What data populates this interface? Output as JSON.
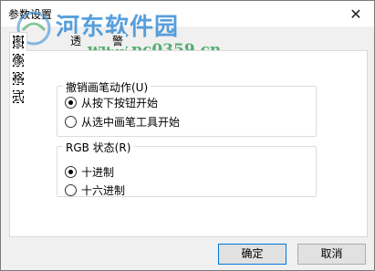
{
  "window": {
    "title": "参数设置",
    "close_glyph": "✕"
  },
  "watermark": {
    "site_name": "河东软件园",
    "url": "www.pc0359.cn"
  },
  "tabs": [
    {
      "label": "图像格式",
      "active": true
    },
    {
      "label": "透明色",
      "active": false
    },
    {
      "label": "警告信息",
      "active": false
    }
  ],
  "group_undo": {
    "legend": "撤销画笔动作(U)",
    "options": [
      {
        "label": "从按下按钮开始",
        "checked": true
      },
      {
        "label": "从选中画笔工具开始",
        "checked": false
      }
    ]
  },
  "group_rgb": {
    "legend": "RGB 状态(R)",
    "options": [
      {
        "label": "十进制",
        "checked": true
      },
      {
        "label": "十六进制",
        "checked": false
      }
    ]
  },
  "buttons": {
    "ok": "确定",
    "cancel": "取消"
  },
  "colors": {
    "accent": "#0078d7",
    "watermark_blue": "#3a8fd6",
    "watermark_green": "#3aa35a"
  }
}
